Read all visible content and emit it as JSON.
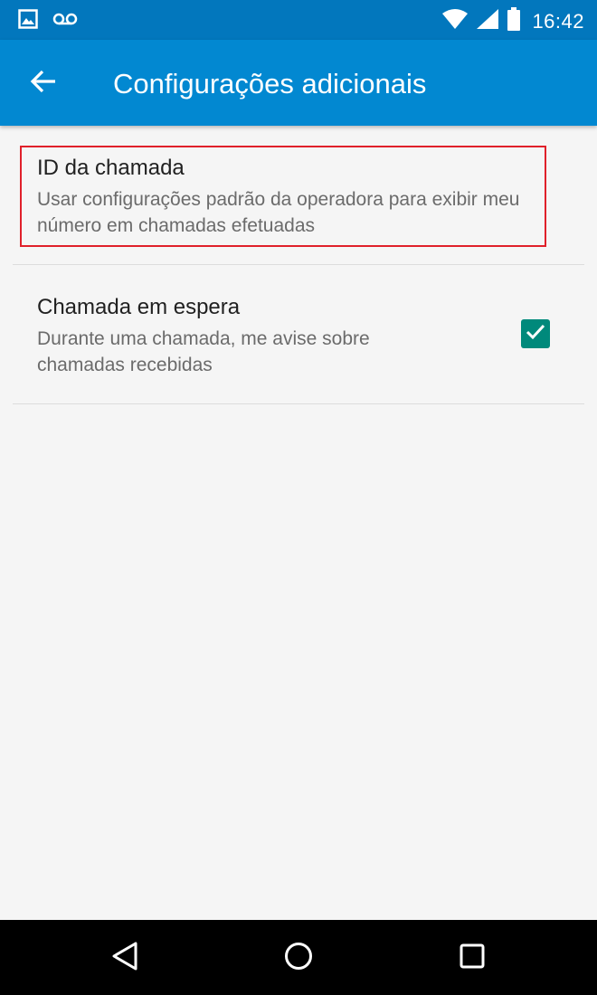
{
  "status_bar": {
    "time": "16:42",
    "icons": [
      "image-notification-icon",
      "voicemail-icon",
      "wifi-icon",
      "signal-icon",
      "battery-icon"
    ]
  },
  "app_bar": {
    "title": "Configurações adicionais",
    "back_icon": "arrow-back-icon"
  },
  "preferences": [
    {
      "title": "ID da chamada",
      "summary": "Usar configurações padrão da operadora para exibir meu número em chamadas efetuadas",
      "highlighted": true
    },
    {
      "title": "Chamada em espera",
      "summary": "Durante uma chamada, me avise sobre chamadas recebidas",
      "checked": true
    }
  ],
  "nav_bar": {
    "icons": [
      "nav-back-icon",
      "nav-home-icon",
      "nav-recents-icon"
    ]
  },
  "colors": {
    "status_bar": "#0277bd",
    "app_bar": "#0288d1",
    "checkbox": "#00897b",
    "highlight": "#e0202a",
    "background": "#f5f5f5"
  }
}
